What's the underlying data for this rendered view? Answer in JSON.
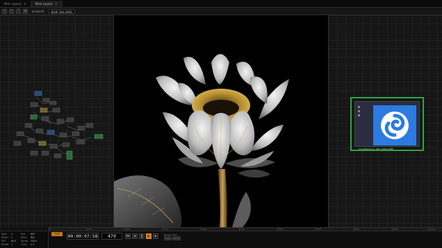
{
  "menubar": {
    "tabs": [
      {
        "label": "Main Layout",
        "active": false
      },
      {
        "label": "Main Layout",
        "active": true
      }
    ]
  },
  "toolbar": {
    "path_label": "/project1",
    "field_value": "BLVE Test.4961"
  },
  "viewer": {
    "subject_icon": "white-lotus-flower-image"
  },
  "op_viewer": {
    "caption": "moviefilein1  pc, 8bit, 1920x1080",
    "tile_icon": "swirl-logo-icon",
    "frame_color": "#37a049",
    "tile_color": "#2b7be0"
  },
  "ruler": {
    "ticks": [
      "1",
      "100",
      "200",
      "300",
      "400",
      "500",
      "600",
      "700",
      "800",
      "900",
      "1000"
    ]
  },
  "info": {
    "rows": [
      {
        "k1": "Start",
        "v1": "1",
        "k2": "End",
        "v2": "600"
      },
      {
        "k1": "RStart",
        "v1": "1",
        "k2": "REnd",
        "v2": "600"
      },
      {
        "k1": "FPS",
        "v1": "60.0",
        "k2": "Tempo",
        "v2": "120.0"
      },
      {
        "k1": "ResetF",
        "v1": "1",
        "k2": "T Sig",
        "v2": "4 4"
      }
    ]
  },
  "transport": {
    "badge": "TOP",
    "timecode": "00:00:07:58",
    "frame": "479",
    "range_label": "Range Limit",
    "range_loop": "Loop",
    "range_once": "Once"
  },
  "colors": {
    "accent": "#c7781d",
    "background": "#121212"
  }
}
